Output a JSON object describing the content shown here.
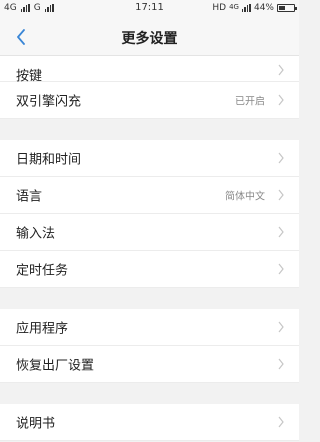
{
  "status_bar": {
    "left_network_1": "4G",
    "left_network_2": "G",
    "time": "17:11",
    "right_network": "HD",
    "right_network_2": "4G",
    "battery_percent": "44%",
    "battery_level": 0.44
  },
  "header": {
    "title": "更多设置",
    "back_icon": "chevron-left-icon"
  },
  "sections": [
    {
      "items": [
        {
          "label": "按键",
          "value": ""
        },
        {
          "label": "双引擎闪充",
          "value": "已开启"
        }
      ]
    },
    {
      "items": [
        {
          "label": "日期和时间",
          "value": ""
        },
        {
          "label": "语言",
          "value": "简体中文"
        },
        {
          "label": "输入法",
          "value": ""
        },
        {
          "label": "定时任务",
          "value": ""
        }
      ]
    },
    {
      "items": [
        {
          "label": "应用程序",
          "value": ""
        },
        {
          "label": "恢复出厂设置",
          "value": ""
        }
      ]
    },
    {
      "items": [
        {
          "label": "说明书",
          "value": ""
        }
      ]
    }
  ],
  "colors": {
    "accent": "#3a86d6",
    "chevron": "#c6c6c6"
  }
}
